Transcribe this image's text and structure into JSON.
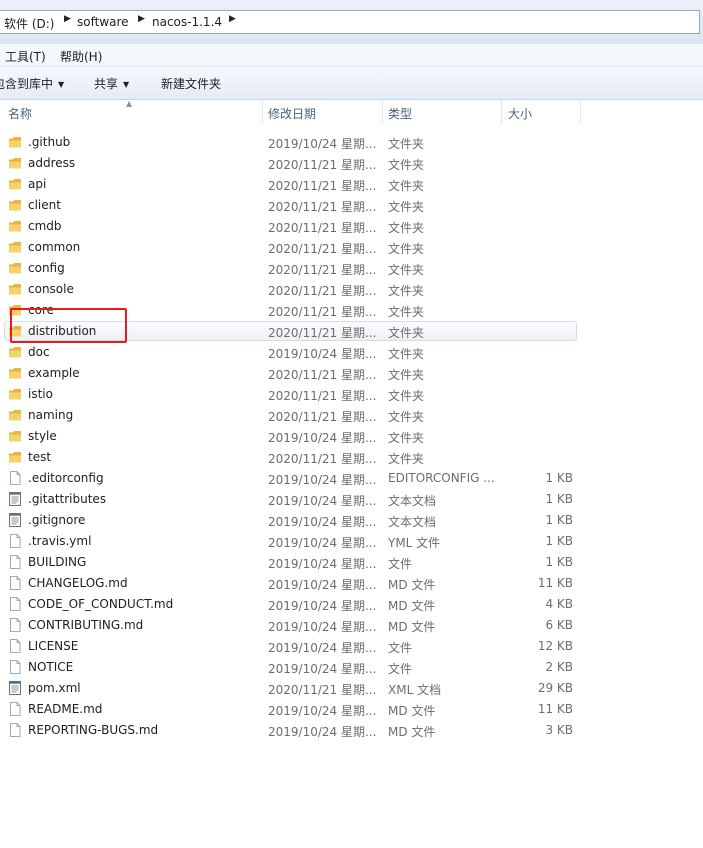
{
  "address_bar": {
    "crumbs": [
      "软件 (D:)",
      "software",
      "nacos-1.1.4"
    ]
  },
  "menu": {
    "items": [
      "工具(T)",
      "帮助(H)"
    ]
  },
  "toolbar": {
    "include_in_library": "包含到库中",
    "share": "共享",
    "new_folder": "新建文件夹"
  },
  "columns": {
    "name": "名称",
    "date": "修改日期",
    "type": "类型",
    "size": "大小"
  },
  "files": [
    {
      "name": ".github",
      "date": "2019/10/24 星期...",
      "type": "文件夹",
      "size": "",
      "icon": "folder-icon"
    },
    {
      "name": "address",
      "date": "2020/11/21 星期...",
      "type": "文件夹",
      "size": "",
      "icon": "folder-icon"
    },
    {
      "name": "api",
      "date": "2020/11/21 星期...",
      "type": "文件夹",
      "size": "",
      "icon": "folder-icon"
    },
    {
      "name": "client",
      "date": "2020/11/21 星期...",
      "type": "文件夹",
      "size": "",
      "icon": "folder-icon"
    },
    {
      "name": "cmdb",
      "date": "2020/11/21 星期...",
      "type": "文件夹",
      "size": "",
      "icon": "folder-icon"
    },
    {
      "name": "common",
      "date": "2020/11/21 星期...",
      "type": "文件夹",
      "size": "",
      "icon": "folder-icon"
    },
    {
      "name": "config",
      "date": "2020/11/21 星期...",
      "type": "文件夹",
      "size": "",
      "icon": "folder-icon"
    },
    {
      "name": "console",
      "date": "2020/11/21 星期...",
      "type": "文件夹",
      "size": "",
      "icon": "folder-icon"
    },
    {
      "name": "core",
      "date": "2020/11/21 星期...",
      "type": "文件夹",
      "size": "",
      "icon": "folder-icon"
    },
    {
      "name": "distribution",
      "date": "2020/11/21 星期...",
      "type": "文件夹",
      "size": "",
      "icon": "folder-icon",
      "highlighted": true
    },
    {
      "name": "doc",
      "date": "2019/10/24 星期...",
      "type": "文件夹",
      "size": "",
      "icon": "folder-icon"
    },
    {
      "name": "example",
      "date": "2020/11/21 星期...",
      "type": "文件夹",
      "size": "",
      "icon": "folder-icon"
    },
    {
      "name": "istio",
      "date": "2020/11/21 星期...",
      "type": "文件夹",
      "size": "",
      "icon": "folder-icon"
    },
    {
      "name": "naming",
      "date": "2020/11/21 星期...",
      "type": "文件夹",
      "size": "",
      "icon": "folder-icon"
    },
    {
      "name": "style",
      "date": "2019/10/24 星期...",
      "type": "文件夹",
      "size": "",
      "icon": "folder-icon"
    },
    {
      "name": "test",
      "date": "2020/11/21 星期...",
      "type": "文件夹",
      "size": "",
      "icon": "folder-icon"
    },
    {
      "name": ".editorconfig",
      "date": "2019/10/24 星期...",
      "type": "EDITORCONFIG ...",
      "size": "1 KB",
      "icon": "file-icon"
    },
    {
      "name": ".gitattributes",
      "date": "2019/10/24 星期...",
      "type": "文本文档",
      "size": "1 KB",
      "icon": "text-file-icon"
    },
    {
      "name": ".gitignore",
      "date": "2019/10/24 星期...",
      "type": "文本文档",
      "size": "1 KB",
      "icon": "text-file-icon"
    },
    {
      "name": ".travis.yml",
      "date": "2019/10/24 星期...",
      "type": "YML 文件",
      "size": "1 KB",
      "icon": "file-icon"
    },
    {
      "name": "BUILDING",
      "date": "2019/10/24 星期...",
      "type": "文件",
      "size": "1 KB",
      "icon": "file-icon"
    },
    {
      "name": "CHANGELOG.md",
      "date": "2019/10/24 星期...",
      "type": "MD 文件",
      "size": "11 KB",
      "icon": "file-icon"
    },
    {
      "name": "CODE_OF_CONDUCT.md",
      "date": "2019/10/24 星期...",
      "type": "MD 文件",
      "size": "4 KB",
      "icon": "file-icon"
    },
    {
      "name": "CONTRIBUTING.md",
      "date": "2019/10/24 星期...",
      "type": "MD 文件",
      "size": "6 KB",
      "icon": "file-icon"
    },
    {
      "name": "LICENSE",
      "date": "2019/10/24 星期...",
      "type": "文件",
      "size": "12 KB",
      "icon": "file-icon"
    },
    {
      "name": "NOTICE",
      "date": "2019/10/24 星期...",
      "type": "文件",
      "size": "2 KB",
      "icon": "file-icon"
    },
    {
      "name": "pom.xml",
      "date": "2020/11/21 星期...",
      "type": "XML 文档",
      "size": "29 KB",
      "icon": "xml-file-icon"
    },
    {
      "name": "README.md",
      "date": "2019/10/24 星期...",
      "type": "MD 文件",
      "size": "11 KB",
      "icon": "file-icon"
    },
    {
      "name": "REPORTING-BUGS.md",
      "date": "2019/10/24 星期...",
      "type": "MD 文件",
      "size": "3 KB",
      "icon": "file-icon"
    }
  ],
  "colors": {
    "annotation_box": "#e31d1d",
    "folder": "#f2c94c",
    "header_text": "#4c607a"
  }
}
